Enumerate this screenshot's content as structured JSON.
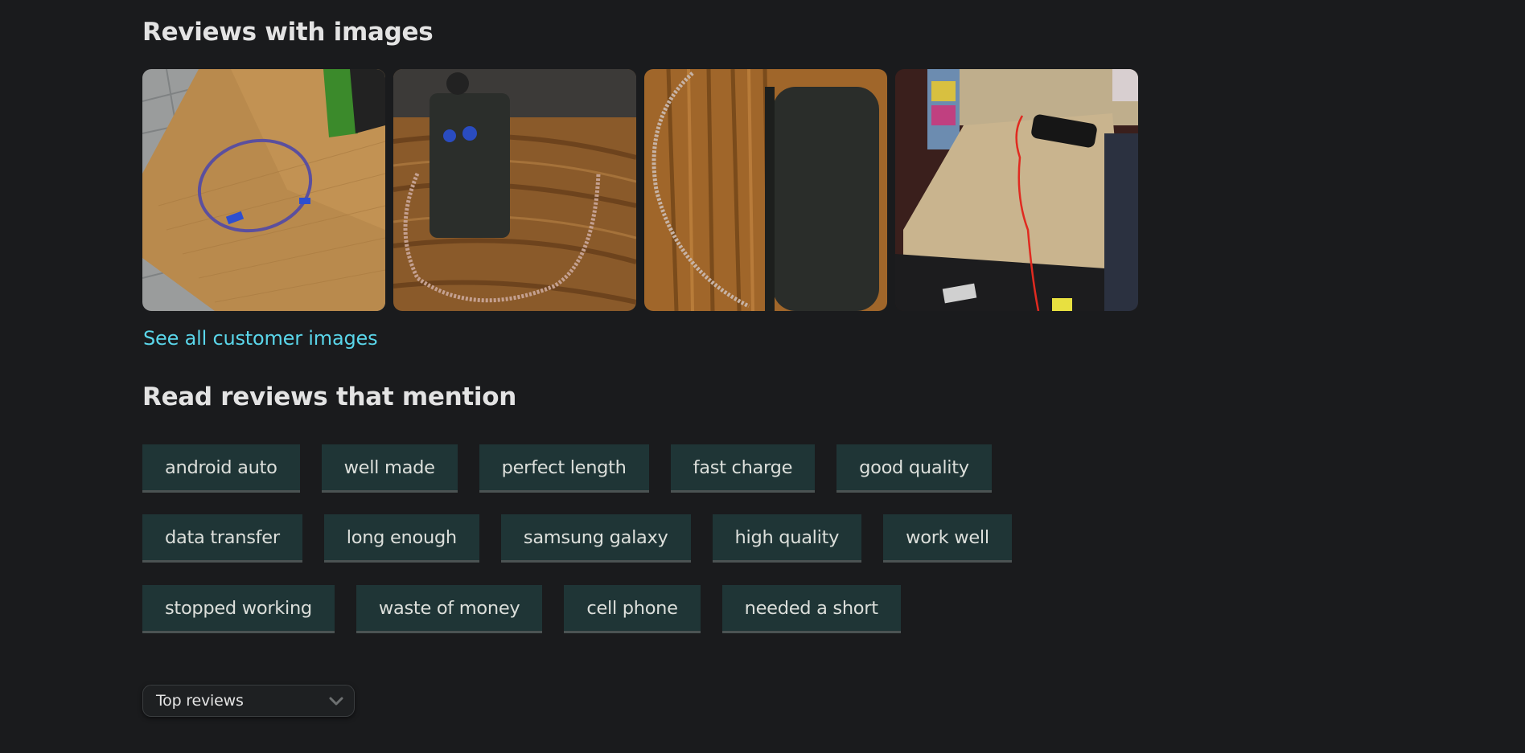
{
  "images_section": {
    "title": "Reviews with images",
    "images": [
      {
        "alt": "Purple braided USB cable coiled on wooden table"
      },
      {
        "alt": "Black power bank with braided cable on wooden table"
      },
      {
        "alt": "Braided cable next to black power bank on wood surface"
      },
      {
        "alt": "Small black power bank with red cable on beige couch cushion"
      }
    ],
    "see_all_link": "See all customer images"
  },
  "mentions_section": {
    "title": "Read reviews that mention",
    "rows": [
      [
        "android auto",
        "well made",
        "perfect length",
        "fast charge",
        "good quality"
      ],
      [
        "data transfer",
        "long enough",
        "samsung galaxy",
        "high quality",
        "work well"
      ],
      [
        "stopped working",
        "waste of money",
        "cell phone",
        "needed a short"
      ]
    ]
  },
  "sort": {
    "selected": "Top reviews",
    "icon": "chevron-down-icon"
  },
  "colors": {
    "background": "#1a1b1d",
    "heading": "#e3e3e3",
    "link": "#5ad6ea",
    "chip_bg": "#1f3536",
    "chip_border": "#4b5353",
    "chip_text": "#dcdfdb"
  }
}
